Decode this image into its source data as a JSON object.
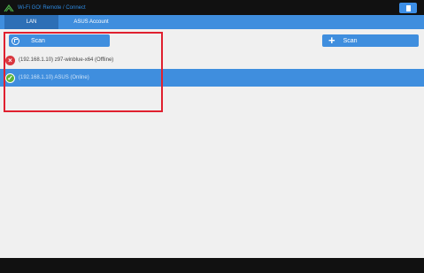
{
  "window": {
    "title": "Wi-Fi GO! Remote / Connect",
    "app_icon": "wifi-go-icon",
    "menu_icon": "document-icon"
  },
  "tabs": [
    {
      "label": "LAN",
      "selected": true
    },
    {
      "label": "ASUS Account",
      "selected": false
    }
  ],
  "toolbar": {
    "scan_label": "Scan",
    "scan_icon": "radar-icon",
    "add_scan_label": "Scan",
    "add_icon": "plus-icon"
  },
  "devices": [
    {
      "label": "(192.168.1.10) z97-winblue-x64 (Offline)",
      "status": "offline",
      "status_icon": "error-x-icon"
    },
    {
      "label": "(192.168.1.10) ASUS (Online)",
      "status": "online",
      "status_icon": "checkmark-icon",
      "selected": true
    }
  ],
  "colors": {
    "accent": "#3f8ede",
    "tab_selected": "#2d6fb6",
    "offline": "#d9363e",
    "online": "#58b43a",
    "highlight": "#e0202f"
  }
}
